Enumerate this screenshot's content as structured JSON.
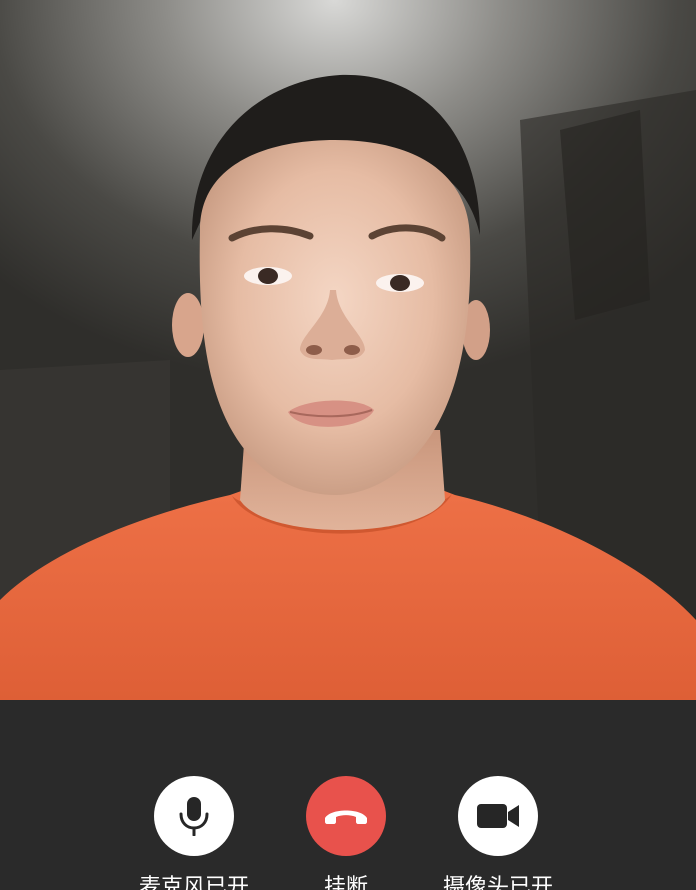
{
  "video": {
    "description_icon": "camera-preview"
  },
  "controls": {
    "microphone": {
      "label": "麦克风已开",
      "icon": "microphone-icon"
    },
    "hangup": {
      "label": "挂断",
      "icon": "phone-hangup-icon",
      "color": "#e8524c"
    },
    "camera": {
      "label": "摄像头已开",
      "icon": "video-camera-icon"
    }
  },
  "colors": {
    "control_bar": "#2a2a2a",
    "button_bg": "#ffffff",
    "hangup_bg": "#e8524c",
    "shirt": "#e5673f"
  }
}
